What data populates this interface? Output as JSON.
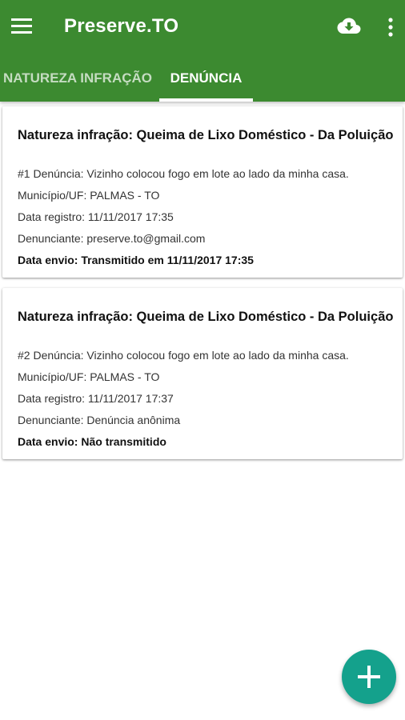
{
  "app": {
    "title": "Preserve.TO",
    "icons": {
      "menu": "menu-icon",
      "cloud": "cloud-download-icon",
      "more": "more-vert-icon",
      "fab": "plus-icon"
    },
    "colors": {
      "primary": "#3c8a30",
      "accent": "#14a18c"
    }
  },
  "tabs": [
    {
      "label": "NATUREZA INFRAÇÃO",
      "active": false
    },
    {
      "label": "DENÚNCIA",
      "active": true
    }
  ],
  "denuncias": [
    {
      "title": "Natureza infração: Queima de Lixo Doméstico - Da Poluição",
      "denuncia": "#1 Denúncia: Vizinho colocou fogo em lote ao lado da minha casa.",
      "municipio": "Município/UF: PALMAS - TO",
      "data_registro": "Data registro: 11/11/2017 17:35",
      "denunciante": "Denunciante: preserve.to@gmail.com",
      "data_envio": "Data envio: Transmitido em 11/11/2017 17:35"
    },
    {
      "title": "Natureza infração: Queima de Lixo Doméstico - Da Poluição",
      "denuncia": "#2 Denúncia: Vizinho colocou fogo em lote ao lado da minha casa.",
      "municipio": "Município/UF: PALMAS - TO",
      "data_registro": "Data registro: 11/11/2017 17:37",
      "denunciante": "Denunciante: Denúncia anônima",
      "data_envio": "Data envio: Não transmitido"
    }
  ]
}
